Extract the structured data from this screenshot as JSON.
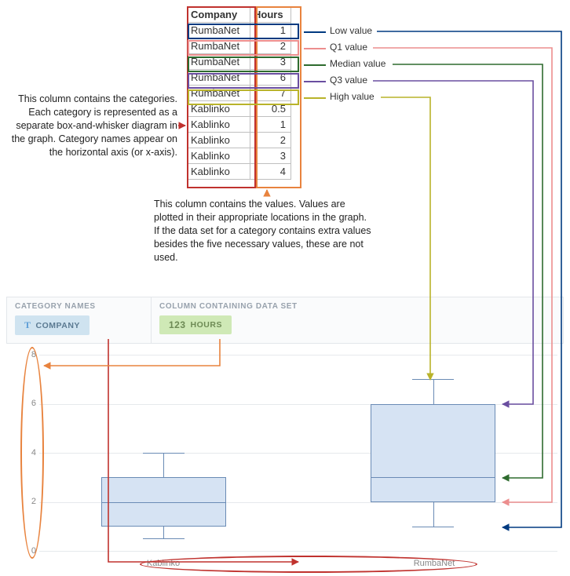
{
  "table": {
    "headers": {
      "company": "Company",
      "hours": "Hours"
    },
    "rows": [
      {
        "company": "RumbaNet",
        "hours": "1"
      },
      {
        "company": "RumbaNet",
        "hours": "2"
      },
      {
        "company": "RumbaNet",
        "hours": "3"
      },
      {
        "company": "RumbaNet",
        "hours": "6"
      },
      {
        "company": "RumbaNet",
        "hours": "7"
      },
      {
        "company": "Kablinko",
        "hours": "0.5"
      },
      {
        "company": "Kablinko",
        "hours": "1"
      },
      {
        "company": "Kablinko",
        "hours": "2"
      },
      {
        "company": "Kablinko",
        "hours": "3"
      },
      {
        "company": "Kablinko",
        "hours": "4"
      }
    ]
  },
  "value_labels": {
    "low": "Low value",
    "q1": "Q1 value",
    "median": "Median value",
    "q3": "Q3 value",
    "high": "High value"
  },
  "explanations": {
    "categories": "This column contains the categories. Each category is represented as a separate box-and-whisker diagram in the graph. Category names appear on the horizontal axis (or x-axis).",
    "values": "This column contains the values. Values are plotted in their appropriate locations in the graph. If the data set for a category contains extra values besides the five necessary values, these are not used."
  },
  "config": {
    "category_title": "CATEGORY NAMES",
    "dataset_title": "COLUMN CONTAINING DATA SET",
    "company_pill": "COMPANY",
    "hours_pill": "HOURS",
    "hours_glyph": "123"
  },
  "chart_data": {
    "type": "boxplot",
    "xlabel": "",
    "ylabel": "",
    "ylim": [
      0,
      8
    ],
    "yticks": [
      0,
      2,
      4,
      6,
      8
    ],
    "categories": [
      "Kablinko",
      "RumbaNet"
    ],
    "series": [
      {
        "name": "Kablinko",
        "low": 0.5,
        "q1": 1,
        "median": 2,
        "q3": 3,
        "high": 4
      },
      {
        "name": "RumbaNet",
        "low": 1,
        "q1": 2,
        "median": 3,
        "q3": 6,
        "high": 7
      }
    ]
  },
  "colors": {
    "company_col": "#c0322e",
    "hours_col": "#e8833e",
    "low": "#003a80",
    "q1": "#ec8e8e",
    "median": "#2e6b2e",
    "q3": "#6a4ea0",
    "high": "#b9b32a",
    "box_fill": "#d6e3f3",
    "box_stroke": "#6a8bb5"
  }
}
